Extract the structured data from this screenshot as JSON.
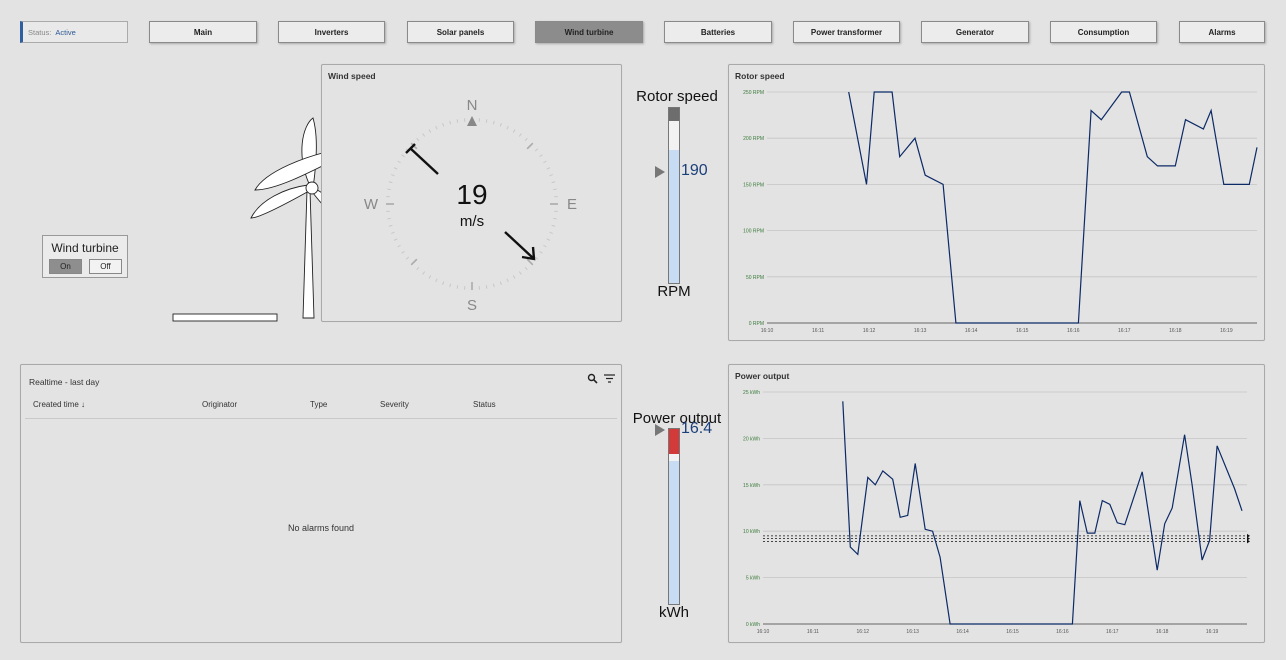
{
  "status": {
    "label": "Status:",
    "value": "Active"
  },
  "nav": [
    {
      "label": "Main",
      "active": false
    },
    {
      "label": "Inverters",
      "active": false
    },
    {
      "label": "Solar panels",
      "active": false
    },
    {
      "label": "Wind turbine",
      "active": true
    },
    {
      "label": "Batteries",
      "active": false
    },
    {
      "label": "Power transformer",
      "active": false
    },
    {
      "label": "Generator",
      "active": false
    },
    {
      "label": "Consumption",
      "active": false
    },
    {
      "label": "Alarms",
      "active": false
    }
  ],
  "turbine": {
    "title": "Wind turbine",
    "on_label": "On",
    "off_label": "Off",
    "state": "On"
  },
  "wind": {
    "title": "Wind speed",
    "value": "19",
    "unit": "m/s",
    "dirs": {
      "n": "N",
      "e": "E",
      "s": "S",
      "w": "W"
    }
  },
  "rotor_gauge": {
    "title": "Rotor speed",
    "value": "190",
    "unit": "RPM",
    "fill_fraction": 0.76
  },
  "power_gauge": {
    "title": "Power output",
    "value": "16.4",
    "unit": "kWh",
    "fill_fraction": 0.82
  },
  "alarms": {
    "title": "Realtime - last day",
    "columns": [
      "Created time ↓",
      "Originator",
      "Type",
      "Severity",
      "Status"
    ],
    "empty": "No alarms found"
  },
  "colors": {
    "line": "#0c2a66",
    "accent": "#2d5a94",
    "tick_label": "#3a7a3a",
    "alarm_fill": "#d33a3a"
  },
  "chart_data": [
    {
      "type": "line",
      "title": "Rotor speed",
      "x_ticks": [
        "16:10",
        "16:11",
        "16:12",
        "16:13",
        "16:14",
        "16:15",
        "16:16",
        "16:17",
        "16:18",
        "16:19"
      ],
      "y_ticks": [
        "0 RPM",
        "50 RPM",
        "100 RPM",
        "150 RPM",
        "200 RPM",
        "250 RPM"
      ],
      "ylim": [
        0,
        250
      ],
      "xlim": [
        0,
        9.6
      ],
      "series": [
        {
          "points": [
            [
              1.6,
              250
            ],
            [
              1.95,
              150
            ],
            [
              2.1,
              250
            ],
            [
              2.45,
              250
            ],
            [
              2.6,
              180
            ],
            [
              2.9,
              200
            ],
            [
              3.1,
              160
            ],
            [
              3.45,
              150
            ],
            [
              3.7,
              0
            ],
            [
              6.1,
              0
            ],
            [
              6.35,
              230
            ],
            [
              6.55,
              220
            ],
            [
              6.95,
              250
            ],
            [
              7.1,
              250
            ],
            [
              7.45,
              180
            ],
            [
              7.65,
              170
            ],
            [
              8.0,
              170
            ],
            [
              8.2,
              220
            ],
            [
              8.55,
              210
            ],
            [
              8.7,
              230
            ],
            [
              8.95,
              150
            ],
            [
              9.45,
              150
            ],
            [
              9.6,
              190
            ]
          ]
        }
      ]
    },
    {
      "type": "line",
      "title": "Power output",
      "x_ticks": [
        "16:10",
        "16:11",
        "16:12",
        "16:13",
        "16:14",
        "16:15",
        "16:16",
        "16:17",
        "16:18",
        "16:19"
      ],
      "y_ticks": [
        "0 kWh",
        "5 kWh",
        "10 kWh",
        "15 kWh",
        "20 kWh",
        "25 kWh"
      ],
      "ylim": [
        0,
        25
      ],
      "xlim": [
        0,
        9.7
      ],
      "series": [
        {
          "points": [
            [
              1.6,
              24
            ],
            [
              1.75,
              8.3
            ],
            [
              1.9,
              7.5
            ],
            [
              2.1,
              15.8
            ],
            [
              2.25,
              15
            ],
            [
              2.4,
              16.5
            ],
            [
              2.6,
              15.6
            ],
            [
              2.75,
              11.5
            ],
            [
              2.9,
              11.7
            ],
            [
              3.05,
              17.3
            ],
            [
              3.25,
              10.2
            ],
            [
              3.4,
              10
            ],
            [
              3.55,
              7.2
            ],
            [
              3.75,
              0
            ],
            [
              6.2,
              0
            ],
            [
              6.35,
              13.3
            ],
            [
              6.5,
              9.8
            ],
            [
              6.65,
              9.8
            ],
            [
              6.8,
              13.3
            ],
            [
              6.95,
              12.9
            ],
            [
              7.1,
              10.9
            ],
            [
              7.25,
              10.7
            ],
            [
              7.6,
              16.4
            ],
            [
              7.9,
              5.8
            ],
            [
              8.05,
              10.8
            ],
            [
              8.2,
              12.5
            ],
            [
              8.45,
              20.4
            ],
            [
              8.6,
              15
            ],
            [
              8.8,
              6.9
            ],
            [
              8.95,
              9
            ],
            [
              9.1,
              19.2
            ],
            [
              9.45,
              14.6
            ],
            [
              9.6,
              12.2
            ]
          ]
        }
      ],
      "reference_lines": [
        9.5,
        9.2,
        8.9
      ]
    }
  ]
}
